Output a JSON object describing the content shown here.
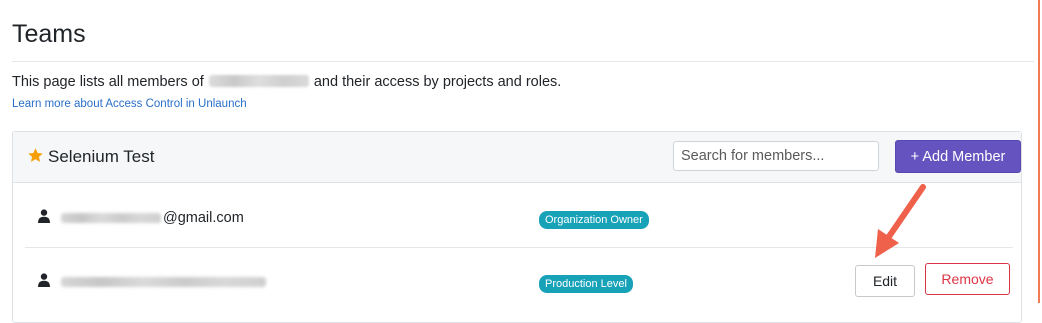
{
  "page": {
    "title": "Teams",
    "description_before": "This page lists all members of",
    "description_after": "and their access by projects and roles.",
    "learn_more": "Learn more about Access Control in Unlaunch"
  },
  "team": {
    "name": "Selenium Test",
    "star_icon": "star-icon",
    "search_placeholder": "Search for members...",
    "add_member_label": "+ Add Member"
  },
  "members": [
    {
      "email_visible": "@gmail.com",
      "role": "Organization Owner",
      "icon": "user-icon"
    },
    {
      "email_visible": "",
      "role": "Production Level",
      "icon": "user-icon",
      "edit_label": "Edit",
      "remove_label": "Remove"
    }
  ],
  "colors": {
    "accent": "#6554c0",
    "star": "#f5a00b",
    "badge": "#17a2b8",
    "danger": "#dc3545",
    "annotation_arrow": "#f0614b",
    "link": "#2a6fc9"
  }
}
